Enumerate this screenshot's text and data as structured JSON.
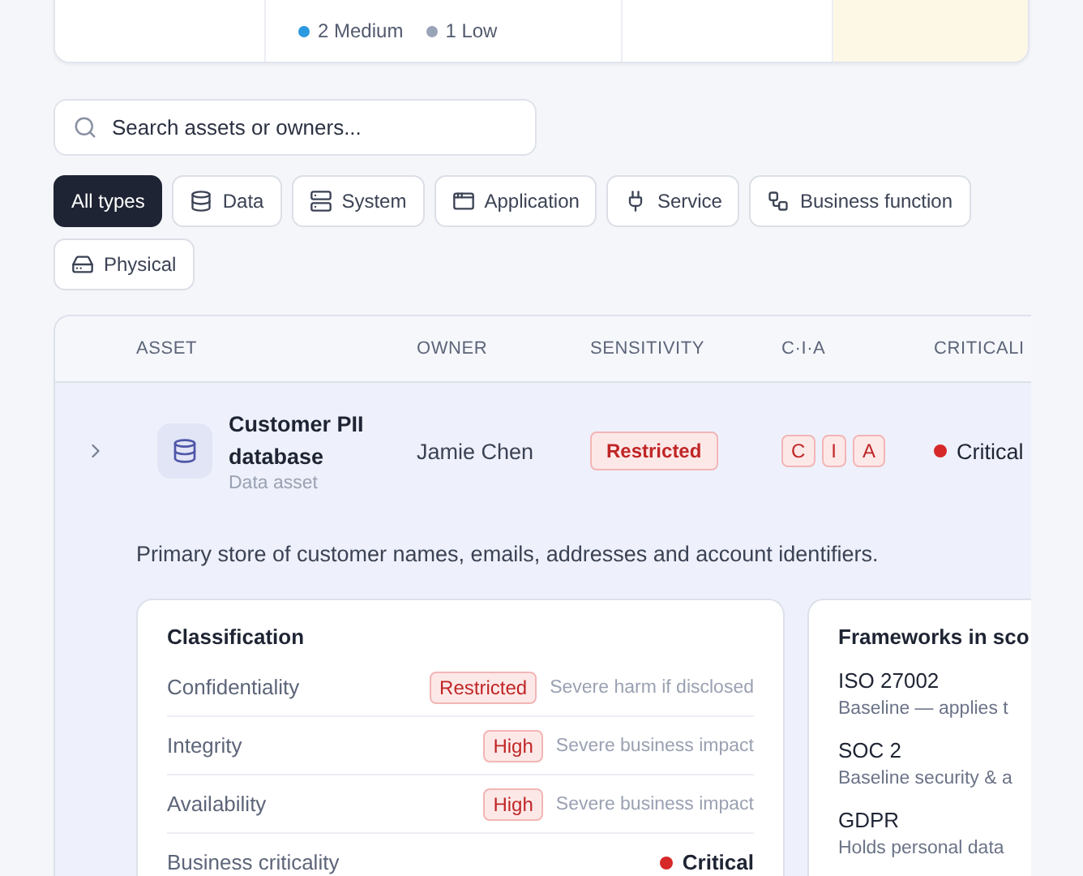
{
  "summary": {
    "legend": [
      {
        "label": "2 Medium",
        "color": "#2a9ae0"
      },
      {
        "label": "1 Low",
        "color": "#9aa3b8"
      }
    ]
  },
  "search": {
    "placeholder": "Search assets or owners..."
  },
  "filters": [
    {
      "label": "All types",
      "kind": "all",
      "selected": true
    },
    {
      "label": "Data",
      "kind": "data",
      "selected": false
    },
    {
      "label": "System",
      "kind": "system",
      "selected": false
    },
    {
      "label": "Application",
      "kind": "application",
      "selected": false
    },
    {
      "label": "Service",
      "kind": "service",
      "selected": false
    },
    {
      "label": "Business function",
      "kind": "function",
      "selected": false
    },
    {
      "label": "Physical",
      "kind": "physical",
      "selected": false
    }
  ],
  "table": {
    "columns": [
      "ASSET",
      "OWNER",
      "SENSITIVITY",
      "C·I·A",
      "CRITICALI"
    ],
    "rows": [
      {
        "name": "Customer PII database",
        "type": "Data asset",
        "owner": "Jamie Chen",
        "sensitivity": "Restricted",
        "cia": [
          "C",
          "I",
          "A"
        ],
        "criticality": "Critical",
        "expanded": true,
        "selected": true,
        "description": "Primary store of customer names, emails, addresses and account identifiers.",
        "classification": {
          "title": "Classification",
          "rows": [
            {
              "kind": "badge",
              "label": "Confidentiality",
              "value": "Restricted",
              "note": "Severe harm if disclosed"
            },
            {
              "kind": "badge",
              "label": "Integrity",
              "value": "High",
              "note": "Severe business impact"
            },
            {
              "kind": "badge",
              "label": "Availability",
              "value": "High",
              "note": "Severe business impact"
            },
            {
              "kind": "dot",
              "label": "Business criticality",
              "value": "Critical",
              "color": "#d62828"
            }
          ]
        },
        "frameworks": {
          "title": "Frameworks in sco",
          "items": [
            {
              "name": "ISO 27002",
              "note": "Baseline — applies t"
            },
            {
              "name": "SOC 2",
              "note": "Baseline security & a"
            },
            {
              "name": "GDPR",
              "note": "Holds personal data"
            }
          ]
        }
      }
    ]
  }
}
